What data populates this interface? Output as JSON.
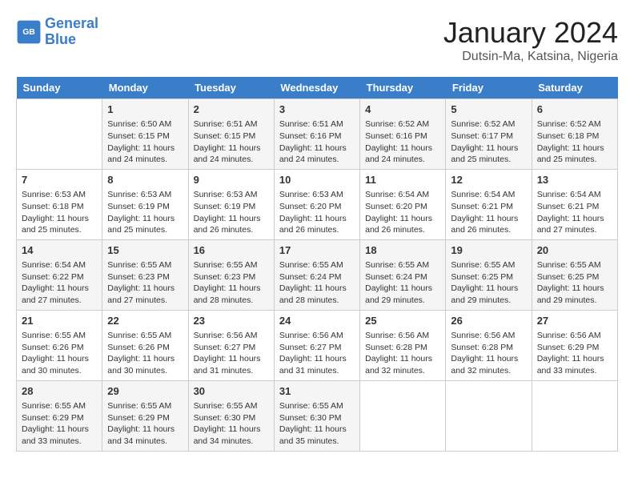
{
  "header": {
    "logo_line1": "General",
    "logo_line2": "Blue",
    "month": "January 2024",
    "location": "Dutsin-Ma, Katsina, Nigeria"
  },
  "weekdays": [
    "Sunday",
    "Monday",
    "Tuesday",
    "Wednesday",
    "Thursday",
    "Friday",
    "Saturday"
  ],
  "weeks": [
    [
      {
        "day": "",
        "sunrise": "",
        "sunset": "",
        "daylight": ""
      },
      {
        "day": "1",
        "sunrise": "Sunrise: 6:50 AM",
        "sunset": "Sunset: 6:15 PM",
        "daylight": "Daylight: 11 hours and 24 minutes."
      },
      {
        "day": "2",
        "sunrise": "Sunrise: 6:51 AM",
        "sunset": "Sunset: 6:15 PM",
        "daylight": "Daylight: 11 hours and 24 minutes."
      },
      {
        "day": "3",
        "sunrise": "Sunrise: 6:51 AM",
        "sunset": "Sunset: 6:16 PM",
        "daylight": "Daylight: 11 hours and 24 minutes."
      },
      {
        "day": "4",
        "sunrise": "Sunrise: 6:52 AM",
        "sunset": "Sunset: 6:16 PM",
        "daylight": "Daylight: 11 hours and 24 minutes."
      },
      {
        "day": "5",
        "sunrise": "Sunrise: 6:52 AM",
        "sunset": "Sunset: 6:17 PM",
        "daylight": "Daylight: 11 hours and 25 minutes."
      },
      {
        "day": "6",
        "sunrise": "Sunrise: 6:52 AM",
        "sunset": "Sunset: 6:18 PM",
        "daylight": "Daylight: 11 hours and 25 minutes."
      }
    ],
    [
      {
        "day": "7",
        "sunrise": "Sunrise: 6:53 AM",
        "sunset": "Sunset: 6:18 PM",
        "daylight": "Daylight: 11 hours and 25 minutes."
      },
      {
        "day": "8",
        "sunrise": "Sunrise: 6:53 AM",
        "sunset": "Sunset: 6:19 PM",
        "daylight": "Daylight: 11 hours and 25 minutes."
      },
      {
        "day": "9",
        "sunrise": "Sunrise: 6:53 AM",
        "sunset": "Sunset: 6:19 PM",
        "daylight": "Daylight: 11 hours and 26 minutes."
      },
      {
        "day": "10",
        "sunrise": "Sunrise: 6:53 AM",
        "sunset": "Sunset: 6:20 PM",
        "daylight": "Daylight: 11 hours and 26 minutes."
      },
      {
        "day": "11",
        "sunrise": "Sunrise: 6:54 AM",
        "sunset": "Sunset: 6:20 PM",
        "daylight": "Daylight: 11 hours and 26 minutes."
      },
      {
        "day": "12",
        "sunrise": "Sunrise: 6:54 AM",
        "sunset": "Sunset: 6:21 PM",
        "daylight": "Daylight: 11 hours and 26 minutes."
      },
      {
        "day": "13",
        "sunrise": "Sunrise: 6:54 AM",
        "sunset": "Sunset: 6:21 PM",
        "daylight": "Daylight: 11 hours and 27 minutes."
      }
    ],
    [
      {
        "day": "14",
        "sunrise": "Sunrise: 6:54 AM",
        "sunset": "Sunset: 6:22 PM",
        "daylight": "Daylight: 11 hours and 27 minutes."
      },
      {
        "day": "15",
        "sunrise": "Sunrise: 6:55 AM",
        "sunset": "Sunset: 6:23 PM",
        "daylight": "Daylight: 11 hours and 27 minutes."
      },
      {
        "day": "16",
        "sunrise": "Sunrise: 6:55 AM",
        "sunset": "Sunset: 6:23 PM",
        "daylight": "Daylight: 11 hours and 28 minutes."
      },
      {
        "day": "17",
        "sunrise": "Sunrise: 6:55 AM",
        "sunset": "Sunset: 6:24 PM",
        "daylight": "Daylight: 11 hours and 28 minutes."
      },
      {
        "day": "18",
        "sunrise": "Sunrise: 6:55 AM",
        "sunset": "Sunset: 6:24 PM",
        "daylight": "Daylight: 11 hours and 29 minutes."
      },
      {
        "day": "19",
        "sunrise": "Sunrise: 6:55 AM",
        "sunset": "Sunset: 6:25 PM",
        "daylight": "Daylight: 11 hours and 29 minutes."
      },
      {
        "day": "20",
        "sunrise": "Sunrise: 6:55 AM",
        "sunset": "Sunset: 6:25 PM",
        "daylight": "Daylight: 11 hours and 29 minutes."
      }
    ],
    [
      {
        "day": "21",
        "sunrise": "Sunrise: 6:55 AM",
        "sunset": "Sunset: 6:26 PM",
        "daylight": "Daylight: 11 hours and 30 minutes."
      },
      {
        "day": "22",
        "sunrise": "Sunrise: 6:55 AM",
        "sunset": "Sunset: 6:26 PM",
        "daylight": "Daylight: 11 hours and 30 minutes."
      },
      {
        "day": "23",
        "sunrise": "Sunrise: 6:56 AM",
        "sunset": "Sunset: 6:27 PM",
        "daylight": "Daylight: 11 hours and 31 minutes."
      },
      {
        "day": "24",
        "sunrise": "Sunrise: 6:56 AM",
        "sunset": "Sunset: 6:27 PM",
        "daylight": "Daylight: 11 hours and 31 minutes."
      },
      {
        "day": "25",
        "sunrise": "Sunrise: 6:56 AM",
        "sunset": "Sunset: 6:28 PM",
        "daylight": "Daylight: 11 hours and 32 minutes."
      },
      {
        "day": "26",
        "sunrise": "Sunrise: 6:56 AM",
        "sunset": "Sunset: 6:28 PM",
        "daylight": "Daylight: 11 hours and 32 minutes."
      },
      {
        "day": "27",
        "sunrise": "Sunrise: 6:56 AM",
        "sunset": "Sunset: 6:29 PM",
        "daylight": "Daylight: 11 hours and 33 minutes."
      }
    ],
    [
      {
        "day": "28",
        "sunrise": "Sunrise: 6:55 AM",
        "sunset": "Sunset: 6:29 PM",
        "daylight": "Daylight: 11 hours and 33 minutes."
      },
      {
        "day": "29",
        "sunrise": "Sunrise: 6:55 AM",
        "sunset": "Sunset: 6:29 PM",
        "daylight": "Daylight: 11 hours and 34 minutes."
      },
      {
        "day": "30",
        "sunrise": "Sunrise: 6:55 AM",
        "sunset": "Sunset: 6:30 PM",
        "daylight": "Daylight: 11 hours and 34 minutes."
      },
      {
        "day": "31",
        "sunrise": "Sunrise: 6:55 AM",
        "sunset": "Sunset: 6:30 PM",
        "daylight": "Daylight: 11 hours and 35 minutes."
      },
      {
        "day": "",
        "sunrise": "",
        "sunset": "",
        "daylight": ""
      },
      {
        "day": "",
        "sunrise": "",
        "sunset": "",
        "daylight": ""
      },
      {
        "day": "",
        "sunrise": "",
        "sunset": "",
        "daylight": ""
      }
    ]
  ]
}
